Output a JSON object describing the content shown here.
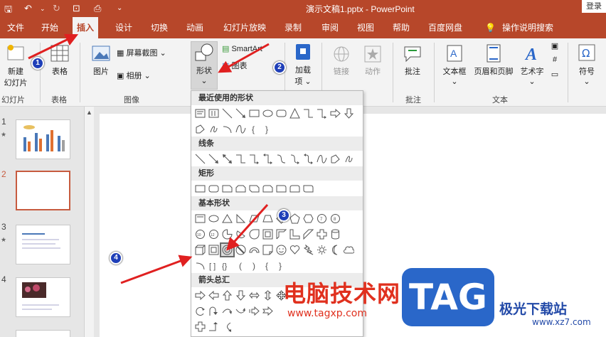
{
  "app": {
    "document_title": "演示文稿1.pptx - PowerPoint",
    "login_label": "登录"
  },
  "tabs": [
    {
      "label": "文件"
    },
    {
      "label": "开始"
    },
    {
      "label": "插入"
    },
    {
      "label": "设计"
    },
    {
      "label": "切换"
    },
    {
      "label": "动画"
    },
    {
      "label": "幻灯片放映"
    },
    {
      "label": "录制"
    },
    {
      "label": "审阅"
    },
    {
      "label": "视图"
    },
    {
      "label": "帮助"
    },
    {
      "label": "百度网盘"
    },
    {
      "label": "操作说明搜索"
    }
  ],
  "active_tab": "插入",
  "ribbon": {
    "new_slide": "新建\n幻灯片",
    "new_slide_line1": "新建",
    "new_slide_line2": "幻灯片",
    "table": "表格",
    "picture": "图片",
    "screenshot": "屏幕截图",
    "album": "相册",
    "shapes": "形状",
    "smartart": "SmartArt",
    "chart": "图表",
    "addins": "加载项",
    "addins_line1": "加载",
    "addins_line2": "项",
    "link": "链接",
    "action": "动作",
    "comment": "批注",
    "textbox": "文本框",
    "header_footer": "页眉和页脚",
    "wordart": "艺术字",
    "symbol": "符号",
    "groups": {
      "slides": "幻灯片",
      "tables": "表格",
      "images": "图像",
      "comments": "批注",
      "text": "文本"
    }
  },
  "slides": [
    {
      "number": "1"
    },
    {
      "number": "2"
    },
    {
      "number": "3"
    },
    {
      "number": "4"
    }
  ],
  "shapes_menu": {
    "sections": [
      {
        "title": "最近使用的形状"
      },
      {
        "title": "线条"
      },
      {
        "title": "矩形"
      },
      {
        "title": "基本形状"
      },
      {
        "title": "箭头总汇"
      }
    ]
  },
  "annotations": {
    "badges": [
      "1",
      "2",
      "3",
      "4"
    ]
  },
  "watermark": {
    "site_name": "电脑技术网",
    "site_url": "www.tagxp.com",
    "logo": "TAG",
    "brand": "极光下载站",
    "brand_url": "www.xz7.com"
  },
  "colors": {
    "accent": "#b7472a",
    "annotation_arrow": "#e02020",
    "badge": "#1f3fb8"
  }
}
